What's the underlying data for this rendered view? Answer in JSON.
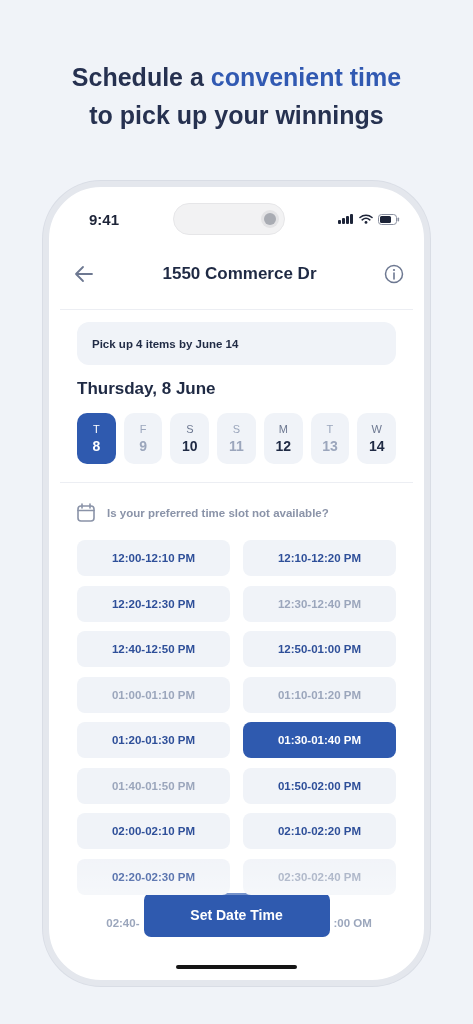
{
  "headline": [
    {
      "text": "Schedule a ",
      "accent": false
    },
    {
      "text": "convenient time",
      "accent": true
    },
    {
      "text": " to pick up your winnings",
      "accent": false
    }
  ],
  "status_bar": {
    "time": "9:41"
  },
  "header": {
    "title": "1550 Commerce Dr"
  },
  "banner": "Pick up 4 items by June 14",
  "date_title": "Thursday, 8 June",
  "days": [
    {
      "weekday": "T",
      "day": "8",
      "available": true,
      "selected": true
    },
    {
      "weekday": "F",
      "day": "9",
      "available": false,
      "selected": false
    },
    {
      "weekday": "S",
      "day": "10",
      "available": true,
      "selected": false
    },
    {
      "weekday": "S",
      "day": "11",
      "available": false,
      "selected": false
    },
    {
      "weekday": "M",
      "day": "12",
      "available": true,
      "selected": false
    },
    {
      "weekday": "T",
      "day": "13",
      "available": false,
      "selected": false
    },
    {
      "weekday": "W",
      "day": "14",
      "available": true,
      "selected": false
    }
  ],
  "hint": "Is your preferred time slot not available?",
  "slots": [
    {
      "label": "12:00-12:10 PM",
      "available": true,
      "selected": false
    },
    {
      "label": "12:10-12:20 PM",
      "available": true,
      "selected": false
    },
    {
      "label": "12:20-12:30 PM",
      "available": true,
      "selected": false
    },
    {
      "label": "12:30-12:40 PM",
      "available": false,
      "selected": false
    },
    {
      "label": "12:40-12:50 PM",
      "available": true,
      "selected": false
    },
    {
      "label": "12:50-01:00 PM",
      "available": true,
      "selected": false
    },
    {
      "label": "01:00-01:10 PM",
      "available": false,
      "selected": false
    },
    {
      "label": "01:10-01:20 PM",
      "available": false,
      "selected": false
    },
    {
      "label": "01:20-01:30 PM",
      "available": true,
      "selected": false
    },
    {
      "label": "01:30-01:40 PM",
      "available": true,
      "selected": true
    },
    {
      "label": "01:40-01:50 PM",
      "available": false,
      "selected": false
    },
    {
      "label": "01:50-02:00 PM",
      "available": true,
      "selected": false
    },
    {
      "label": "02:00-02:10 PM",
      "available": true,
      "selected": false
    },
    {
      "label": "02:10-02:20 PM",
      "available": true,
      "selected": false
    },
    {
      "label": "02:20-02:30 PM",
      "available": true,
      "selected": false
    },
    {
      "label": "02:30-02:40 PM",
      "available": false,
      "selected": false
    }
  ],
  "slot_fragments": [
    "02:40-",
    ":00 OM"
  ],
  "action_button": "Set Date Time"
}
